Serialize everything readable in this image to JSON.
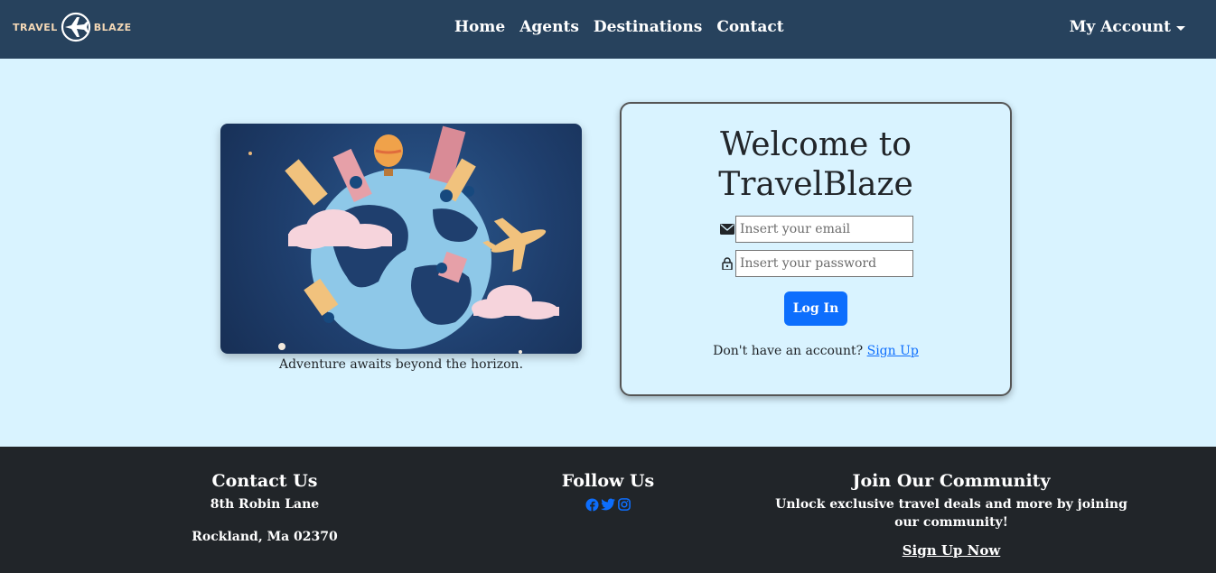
{
  "brand": {
    "left": "TRAVEL",
    "right": "BLAZE",
    "plane_icon": "airplane-logo-icon"
  },
  "nav": {
    "links": [
      "Home",
      "Agents",
      "Destinations",
      "Contact"
    ],
    "account": "My Account"
  },
  "hero": {
    "caption": "Adventure awaits beyond the horizon."
  },
  "login": {
    "title_line1": "Welcome to",
    "title_line2": "TravelBlaze",
    "email_placeholder": "Insert your email",
    "password_placeholder": "Insert your password",
    "button": "Log In",
    "signup_prompt": "Don't have an account?",
    "signup_link": "Sign Up"
  },
  "footer": {
    "contact": {
      "title": "Contact Us",
      "address1": "8th Robin Lane",
      "address2": "Rockland, Ma 02370"
    },
    "follow": {
      "title": "Follow Us",
      "icons": [
        "facebook-icon",
        "twitter-icon",
        "instagram-icon"
      ]
    },
    "community": {
      "title": "Join Our Community",
      "text_line1": "Unlock exclusive travel deals and more by joining",
      "text_line2": "our community!",
      "cta": "Sign Up Now"
    }
  },
  "colors": {
    "navbar": "#27425d",
    "page_bg": "#d9f3ff",
    "primary": "#0d6efd",
    "footer": "#212529",
    "logo": "#f4d8b6"
  }
}
